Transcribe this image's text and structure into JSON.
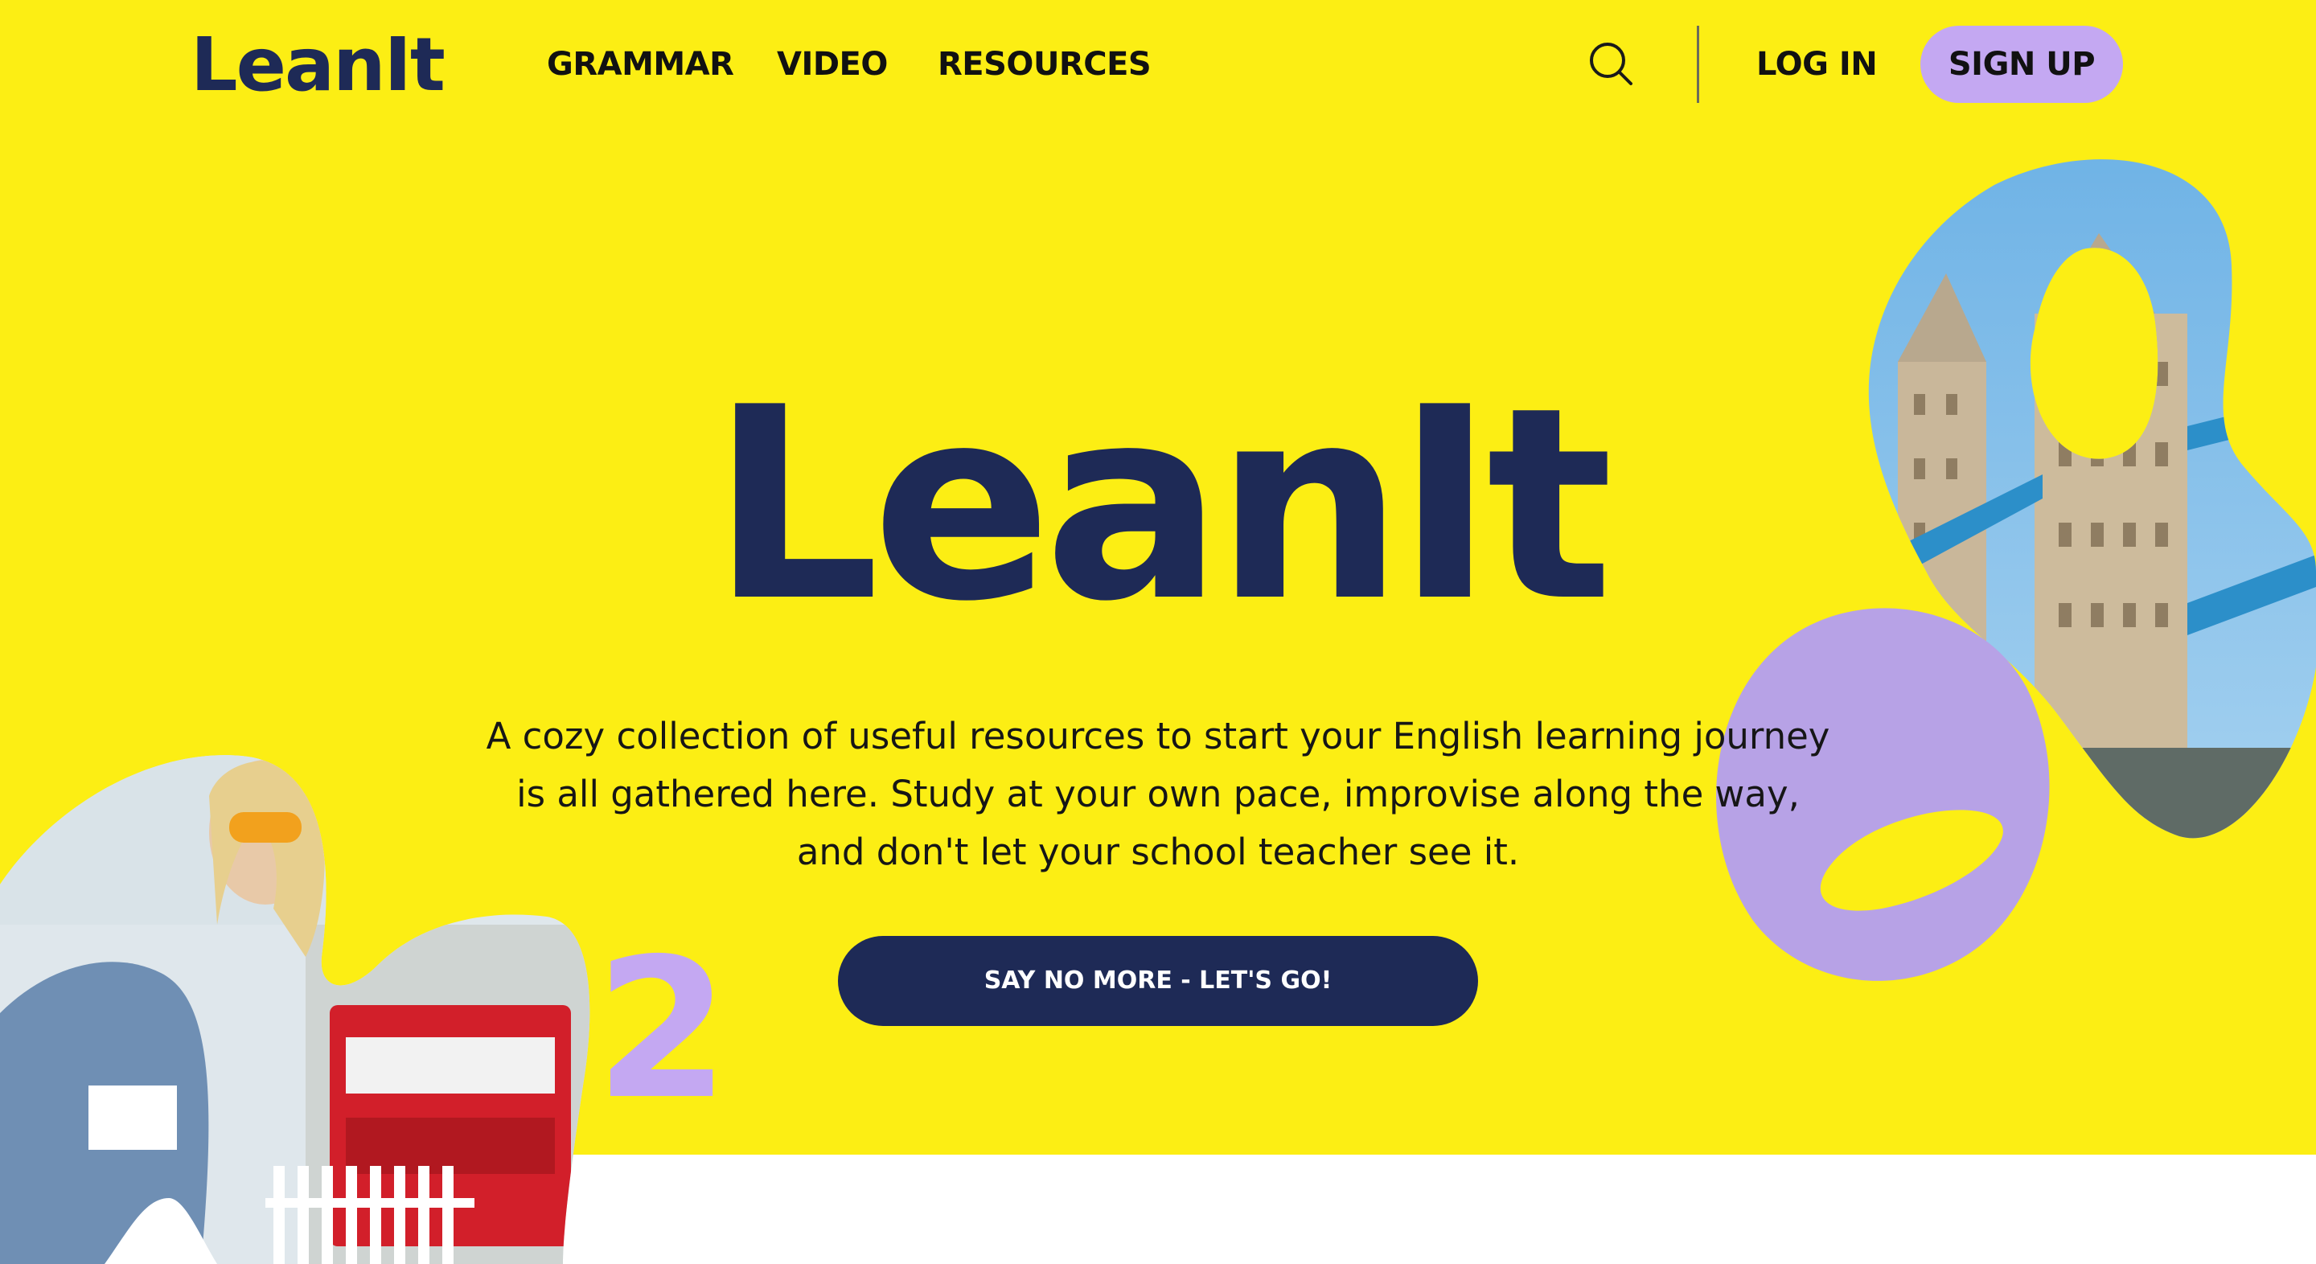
{
  "header": {
    "logo": "LeanIt",
    "nav": [
      "GRAMMAR",
      "VIDEO",
      "RESOURCES"
    ],
    "search_icon": "search-icon",
    "login_label": "LOG IN",
    "signup_label": "SIGN UP"
  },
  "hero": {
    "title": "LeanIt",
    "description": "A cozy collection of useful resources to start your English learning journey is all gathered here. Study at your own pace, improvise along the way, and don't let your school teacher see it.",
    "cta_label": "SAY NO MORE - LET'S GO!",
    "decor_number": "2"
  },
  "colors": {
    "hero_background": "#fcee14",
    "brand_navy": "#1e2a56",
    "accent_lilac": "#c4a8f2",
    "blob_lilac": "#b7a2e6"
  }
}
